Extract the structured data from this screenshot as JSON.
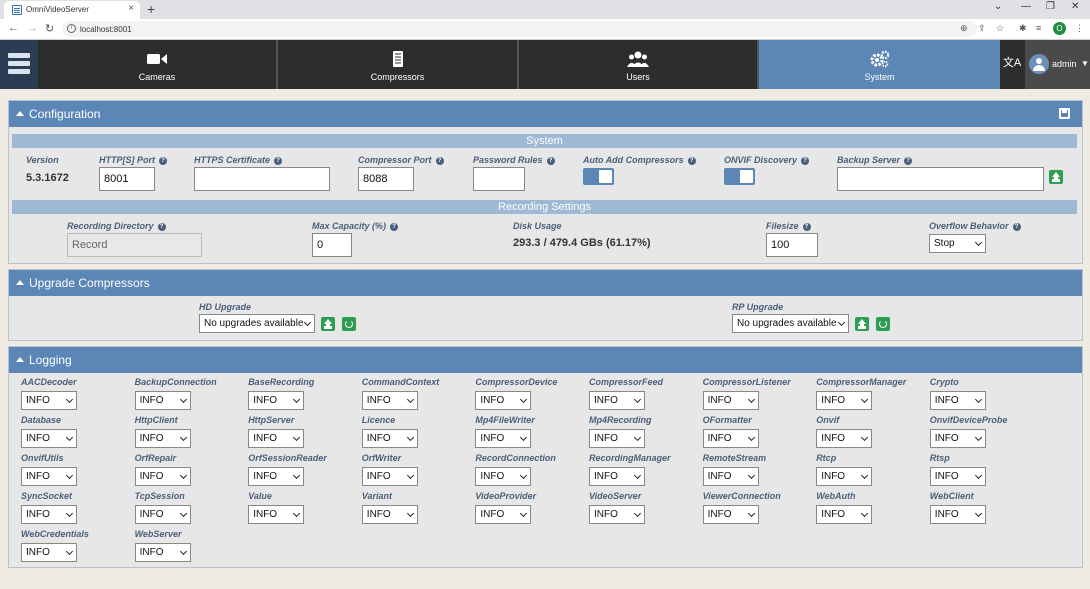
{
  "browser": {
    "tab_title": "OmniVideoServer",
    "url": "localhost:8001",
    "profile_initial": "O"
  },
  "nav": {
    "tabs": [
      {
        "label": "Cameras"
      },
      {
        "label": "Compressors"
      },
      {
        "label": "Users"
      },
      {
        "label": "System"
      }
    ],
    "user": "admin",
    "active_color": "#5b86b6"
  },
  "configuration": {
    "title": "Configuration",
    "system_header": "System",
    "version_label": "Version",
    "version_value": "5.3.1672",
    "http_port_label": "HTTP[S] Port",
    "http_port_value": "8001",
    "https_cert_label": "HTTPS Certificate",
    "https_cert_value": "",
    "compressor_port_label": "Compressor Port",
    "compressor_port_value": "8088",
    "password_rules_label": "Password Rules",
    "password_rules_value": "",
    "auto_add_label": "Auto Add Compressors",
    "auto_add_on": true,
    "onvif_label": "ONVIF Discovery",
    "onvif_on": true,
    "backup_label": "Backup Server",
    "backup_value": "",
    "recording_header": "Recording Settings",
    "rec_dir_label": "Recording Directory",
    "rec_dir_value": "Record",
    "max_cap_label": "Max Capacity (%)",
    "max_cap_value": "0",
    "disk_usage_label": "Disk Usage",
    "disk_usage_value": "293.3 / 479.4 GBs (61.17%)",
    "filesize_label": "Filesize",
    "filesize_value": "100",
    "overflow_label": "Overflow Behavior",
    "overflow_value": "Stop"
  },
  "upgrade": {
    "title": "Upgrade Compressors",
    "hd_label": "HD Upgrade",
    "hd_value": "No upgrades available",
    "rp_label": "RP Upgrade",
    "rp_value": "No upgrades available"
  },
  "logging": {
    "title": "Logging",
    "items": [
      {
        "name": "AACDecoder",
        "level": "INFO"
      },
      {
        "name": "BackupConnection",
        "level": "INFO"
      },
      {
        "name": "BaseRecording",
        "level": "INFO"
      },
      {
        "name": "CommandContext",
        "level": "INFO"
      },
      {
        "name": "CompressorDevice",
        "level": "INFO"
      },
      {
        "name": "CompressorFeed",
        "level": "INFO"
      },
      {
        "name": "CompressorListener",
        "level": "INFO"
      },
      {
        "name": "CompressorManager",
        "level": "INFO"
      },
      {
        "name": "Crypto",
        "level": "INFO"
      },
      {
        "name": "Database",
        "level": "INFO"
      },
      {
        "name": "HttpClient",
        "level": "INFO"
      },
      {
        "name": "HttpServer",
        "level": "INFO"
      },
      {
        "name": "Licence",
        "level": "INFO"
      },
      {
        "name": "Mp4FileWriter",
        "level": "INFO"
      },
      {
        "name": "Mp4Recording",
        "level": "INFO"
      },
      {
        "name": "OFormatter",
        "level": "INFO"
      },
      {
        "name": "Onvif",
        "level": "INFO"
      },
      {
        "name": "OnvifDeviceProbe",
        "level": "INFO"
      },
      {
        "name": "OnvifUtils",
        "level": "INFO"
      },
      {
        "name": "OrfRepair",
        "level": "INFO"
      },
      {
        "name": "OrfSessionReader",
        "level": "INFO"
      },
      {
        "name": "OrfWriter",
        "level": "INFO"
      },
      {
        "name": "RecordConnection",
        "level": "INFO"
      },
      {
        "name": "RecordingManager",
        "level": "INFO"
      },
      {
        "name": "RemoteStream",
        "level": "INFO"
      },
      {
        "name": "Rtcp",
        "level": "INFO"
      },
      {
        "name": "Rtsp",
        "level": "INFO"
      },
      {
        "name": "SyncSocket",
        "level": "INFO"
      },
      {
        "name": "TcpSession",
        "level": "INFO"
      },
      {
        "name": "Value",
        "level": "INFO"
      },
      {
        "name": "Variant",
        "level": "INFO"
      },
      {
        "name": "VideoProvider",
        "level": "INFO"
      },
      {
        "name": "VideoServer",
        "level": "INFO"
      },
      {
        "name": "ViewerConnection",
        "level": "INFO"
      },
      {
        "name": "WebAuth",
        "level": "INFO"
      },
      {
        "name": "WebClient",
        "level": "INFO"
      },
      {
        "name": "WebCredentials",
        "level": "INFO"
      },
      {
        "name": "WebServer",
        "level": "INFO"
      }
    ]
  }
}
